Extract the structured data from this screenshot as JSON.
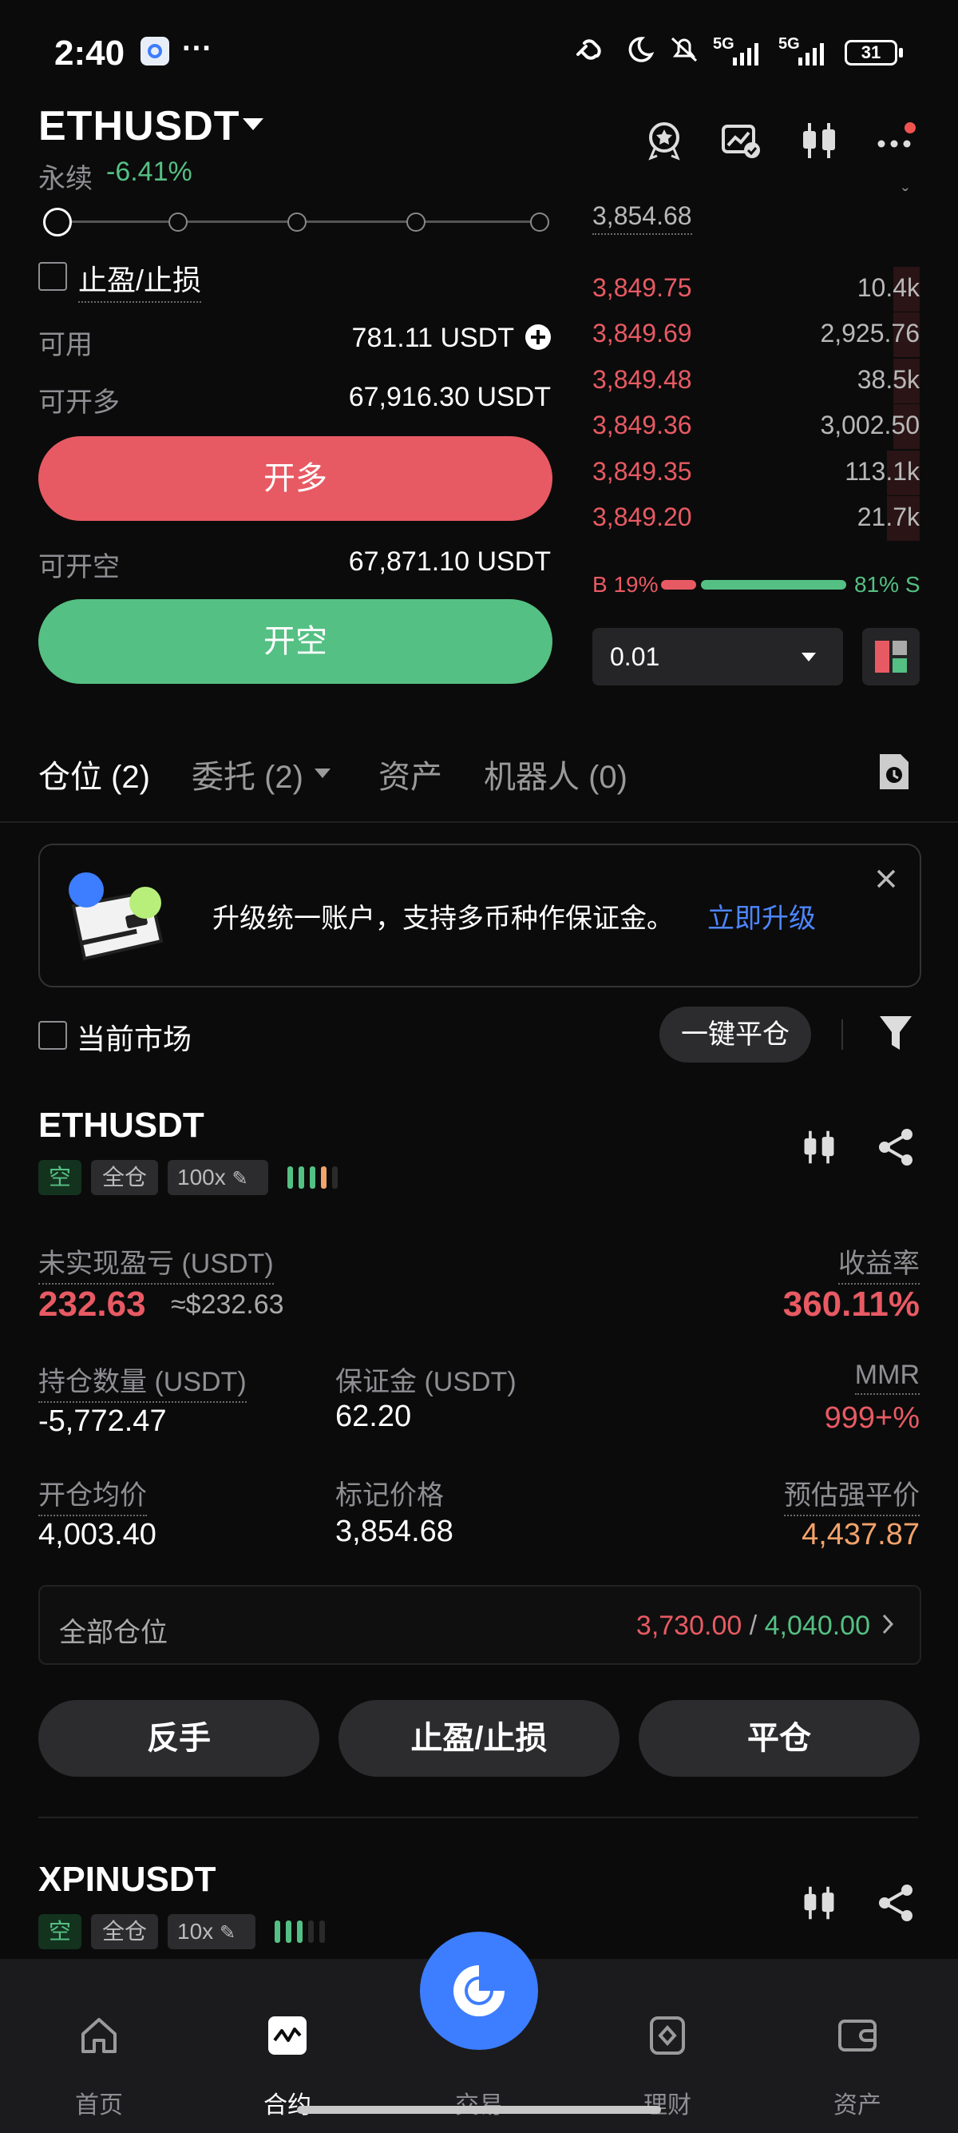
{
  "status": {
    "time": "2:40",
    "dots": "···",
    "net1": "5G",
    "net2": "5G",
    "battery": "31"
  },
  "header": {
    "symbol": "ETHUSDT",
    "type": "永续",
    "change": "-6.41%"
  },
  "order_form": {
    "tpsl_label": "止盈/止损",
    "available_label": "可用",
    "available_value": "781.11 USDT",
    "max_long_label": "可开多",
    "max_long_value": "67,916.30 USDT",
    "long_button": "开多",
    "max_short_label": "可开空",
    "max_short_value": "67,871.10 USDT",
    "short_button": "开空",
    "slider_fraction": 0
  },
  "orderbook": {
    "top_price": "3,854.68",
    "asks": [
      {
        "price": "3,849.75",
        "qty": "10.4k",
        "depth": 0.08
      },
      {
        "price": "3,849.69",
        "qty": "2,925.76",
        "depth": 0.08
      },
      {
        "price": "3,849.48",
        "qty": "38.5k",
        "depth": 0.08
      },
      {
        "price": "3,849.36",
        "qty": "3,002.50",
        "depth": 0.08
      },
      {
        "price": "3,849.35",
        "qty": "113.1k",
        "depth": 0.1
      },
      {
        "price": "3,849.20",
        "qty": "21.7k",
        "depth": 0.1
      }
    ],
    "buy_ratio": "B 19%",
    "sell_ratio": "81% S",
    "buy_fraction": 0.19,
    "precision": "0.01"
  },
  "tabs": [
    {
      "label": "仓位 (2)"
    },
    {
      "label": "委托 (2)"
    },
    {
      "label": "资产"
    },
    {
      "label": "机器人 (0)"
    }
  ],
  "banner": {
    "text": "升级统一账户，支持多币种作保证金。",
    "link": "立即升级"
  },
  "filter": {
    "current_market": "当前市场",
    "close_all": "一键平仓"
  },
  "position": {
    "symbol": "ETHUSDT",
    "side": "空",
    "margin_mode": "全仓",
    "leverage": "100x",
    "unrealized_label": "未实现盈亏 (USDT)",
    "unrealized_value": "232.63",
    "unrealized_usd": "≈$232.63",
    "roe_label": "收益率",
    "roe_value": "360.11%",
    "size_label": "持仓数量 (USDT)",
    "size_value": "-5,772.47",
    "margin_label": "保证金 (USDT)",
    "margin_value": "62.20",
    "mmr_label": "MMR",
    "mmr_value": "999+%",
    "entry_label": "开仓均价",
    "entry_value": "4,003.40",
    "mark_label": "标记价格",
    "mark_value": "3,854.68",
    "liq_label": "预估强平价",
    "liq_value": "4,437.87",
    "all_pos_label": "全部仓位",
    "sl_value": "3,730.00",
    "sep": "/",
    "tp_value": "4,040.00",
    "reverse_button": "反手",
    "tpsl_button": "止盈/止损",
    "close_button": "平仓"
  },
  "position2": {
    "symbol": "XPINUSDT",
    "side": "空",
    "margin_mode": "全仓",
    "leverage": "10x"
  },
  "nav": [
    {
      "label": "首页"
    },
    {
      "label": "合约"
    },
    {
      "label": "交易"
    },
    {
      "label": "理财"
    },
    {
      "label": "资产"
    }
  ],
  "colors": {
    "red": "#e85a63",
    "green": "#55c083",
    "orange": "#f3a36b",
    "link": "#4d86ff",
    "brand": "#3d7dff"
  }
}
